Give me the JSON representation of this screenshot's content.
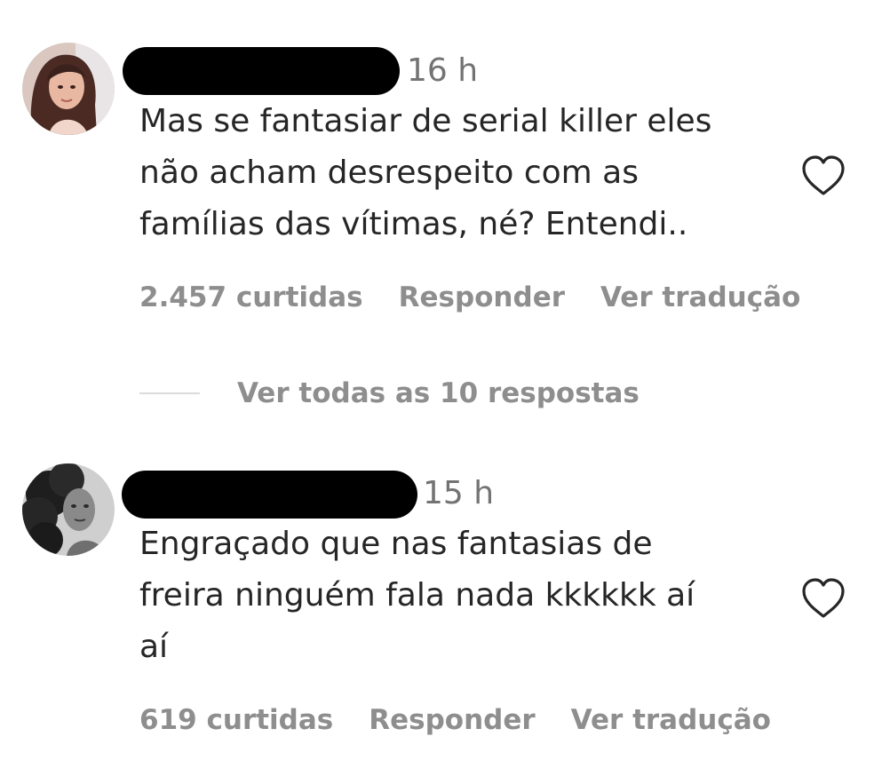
{
  "comments": [
    {
      "timestamp": "16 h",
      "text_lines": [
        "Mas se fantasiar de serial killer eles",
        "não acham desrespeito com as",
        "famílias das vítimas, né? Entendi.."
      ],
      "likes": "2.457 curtidas",
      "reply_label": "Responder",
      "translate_label": "Ver tradução",
      "like_icon": "heart-outline-icon"
    },
    {
      "timestamp": "15 h",
      "text_lines": [
        "Engraçado que nas fantasias de",
        "freira ninguém fala nada kkkkkk aí",
        "aí"
      ],
      "likes": "619 curtidas",
      "reply_label": "Responder",
      "translate_label": "Ver tradução",
      "like_icon": "heart-outline-icon"
    }
  ],
  "view_replies": {
    "label": "Ver todas as 10 respostas"
  },
  "colors": {
    "text": "#262626",
    "secondary": "#8e8e8e",
    "timestamp": "#737373",
    "divider": "#dbdbdb",
    "redaction": "#000000"
  }
}
